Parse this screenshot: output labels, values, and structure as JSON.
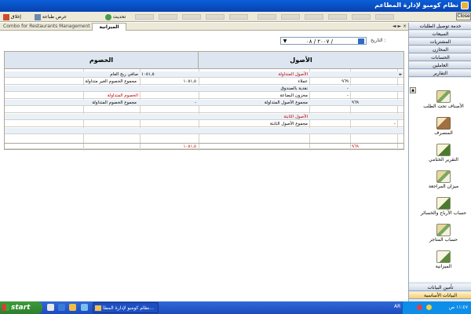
{
  "window": {
    "title": "نظام كومبو لإدارة المطاعم",
    "close_label": "Close"
  },
  "toolbar": {
    "close_btn": "إغلاق",
    "print_preview_btn": "عرض طباعة",
    "refresh_btn": "تحديث"
  },
  "tabs": {
    "document": "Combo for Restaurants Management",
    "active": "الميزانية",
    "controls": "◄ ► ×"
  },
  "date": {
    "label": "التاريخ :",
    "value": "٢٠٠٧ / ٠٨ /"
  },
  "grid": {
    "header_assets": "الأصول",
    "header_liabilities": "الخصوم",
    "rows": [
      {
        "a_label": "الأصول المتداولة",
        "a_red": true,
        "a_sub": "",
        "a_val": "",
        "a_total": "",
        "l_val": "١٠٥١,٥",
        "l_label": "صافي ربح العام",
        "l_red": false,
        "l_total": ""
      },
      {
        "a_label": "عملاء",
        "a_red": false,
        "a_sub": "",
        "a_val": "٩٦٩",
        "a_total": "",
        "l_val": "",
        "l_label": "مجموع الخصوم الغير متداولة",
        "l_red": false,
        "l_total": "١٠٥١,٥"
      },
      {
        "a_label": "نقدية بالصندوق",
        "a_red": false,
        "a_sub": "",
        "a_val": "-",
        "a_total": "",
        "l_val": "",
        "l_label": "",
        "l_red": false,
        "l_total": ""
      },
      {
        "a_label": "مخزون البضاعة",
        "a_red": false,
        "a_sub": "",
        "a_val": "-",
        "a_total": "",
        "l_val": "",
        "l_label": "الخصوم المتداولة",
        "l_red": true,
        "l_total": ""
      },
      {
        "a_label": "مجموع الأصول المتداولة",
        "a_red": false,
        "a_sub": "",
        "a_val": "",
        "a_total": "٩٦٩",
        "l_val": "",
        "l_label": "مجموع الخصوم المتداولة",
        "l_red": false,
        "l_total": "-"
      },
      {
        "a_label": "",
        "a_red": false,
        "a_sub": "",
        "a_val": "",
        "a_total": "",
        "l_val": "",
        "l_label": "",
        "l_red": false,
        "l_total": ""
      },
      {
        "a_label": "الأصول الثابتة",
        "a_red": true,
        "a_sub": "",
        "a_val": "",
        "a_total": "",
        "l_val": "",
        "l_label": "",
        "l_red": false,
        "l_total": ""
      },
      {
        "a_label": "مجموع الأصول الثابتة",
        "a_red": false,
        "a_sub": "",
        "a_val": "",
        "a_total": "-",
        "l_val": "",
        "l_label": "",
        "l_red": false,
        "l_total": ""
      },
      {
        "a_label": "",
        "a_red": false,
        "a_sub": "",
        "a_val": "",
        "a_total": "٩٦٩",
        "l_val": "",
        "l_label": "",
        "l_red": false,
        "l_total": "١٠٥١,٥",
        "totals_red": true
      }
    ]
  },
  "sidebar": {
    "headers": [
      "خدمة توصيل الطلبات",
      "المبيعات",
      "المشتريات",
      "المخازن",
      "الحسابات",
      "العاملين",
      "التقارير"
    ],
    "panel_items": [
      {
        "label": "الأصناف تحت الطلب",
        "icon": "report-icon"
      },
      {
        "label": "المنصرف",
        "icon": "book-icon"
      },
      {
        "label": "التقرير الختامي",
        "icon": "pen-icon"
      },
      {
        "label": "ميزان المراجعة",
        "icon": "report-icon"
      },
      {
        "label": "حساب الأرباح والخسائر",
        "icon": "pen-icon"
      },
      {
        "label": "حساب المتاجر",
        "icon": "report-icon"
      },
      {
        "label": "الميزانية",
        "icon": "scale-icon"
      }
    ],
    "footers": [
      "تأمين البيانات",
      "البيانات الأساسية"
    ]
  },
  "taskbar": {
    "start": "start",
    "task_button": "نظام كومبو لإدارة المطا...",
    "lang": "AR",
    "clock": "١١:٤٧ ص"
  }
}
